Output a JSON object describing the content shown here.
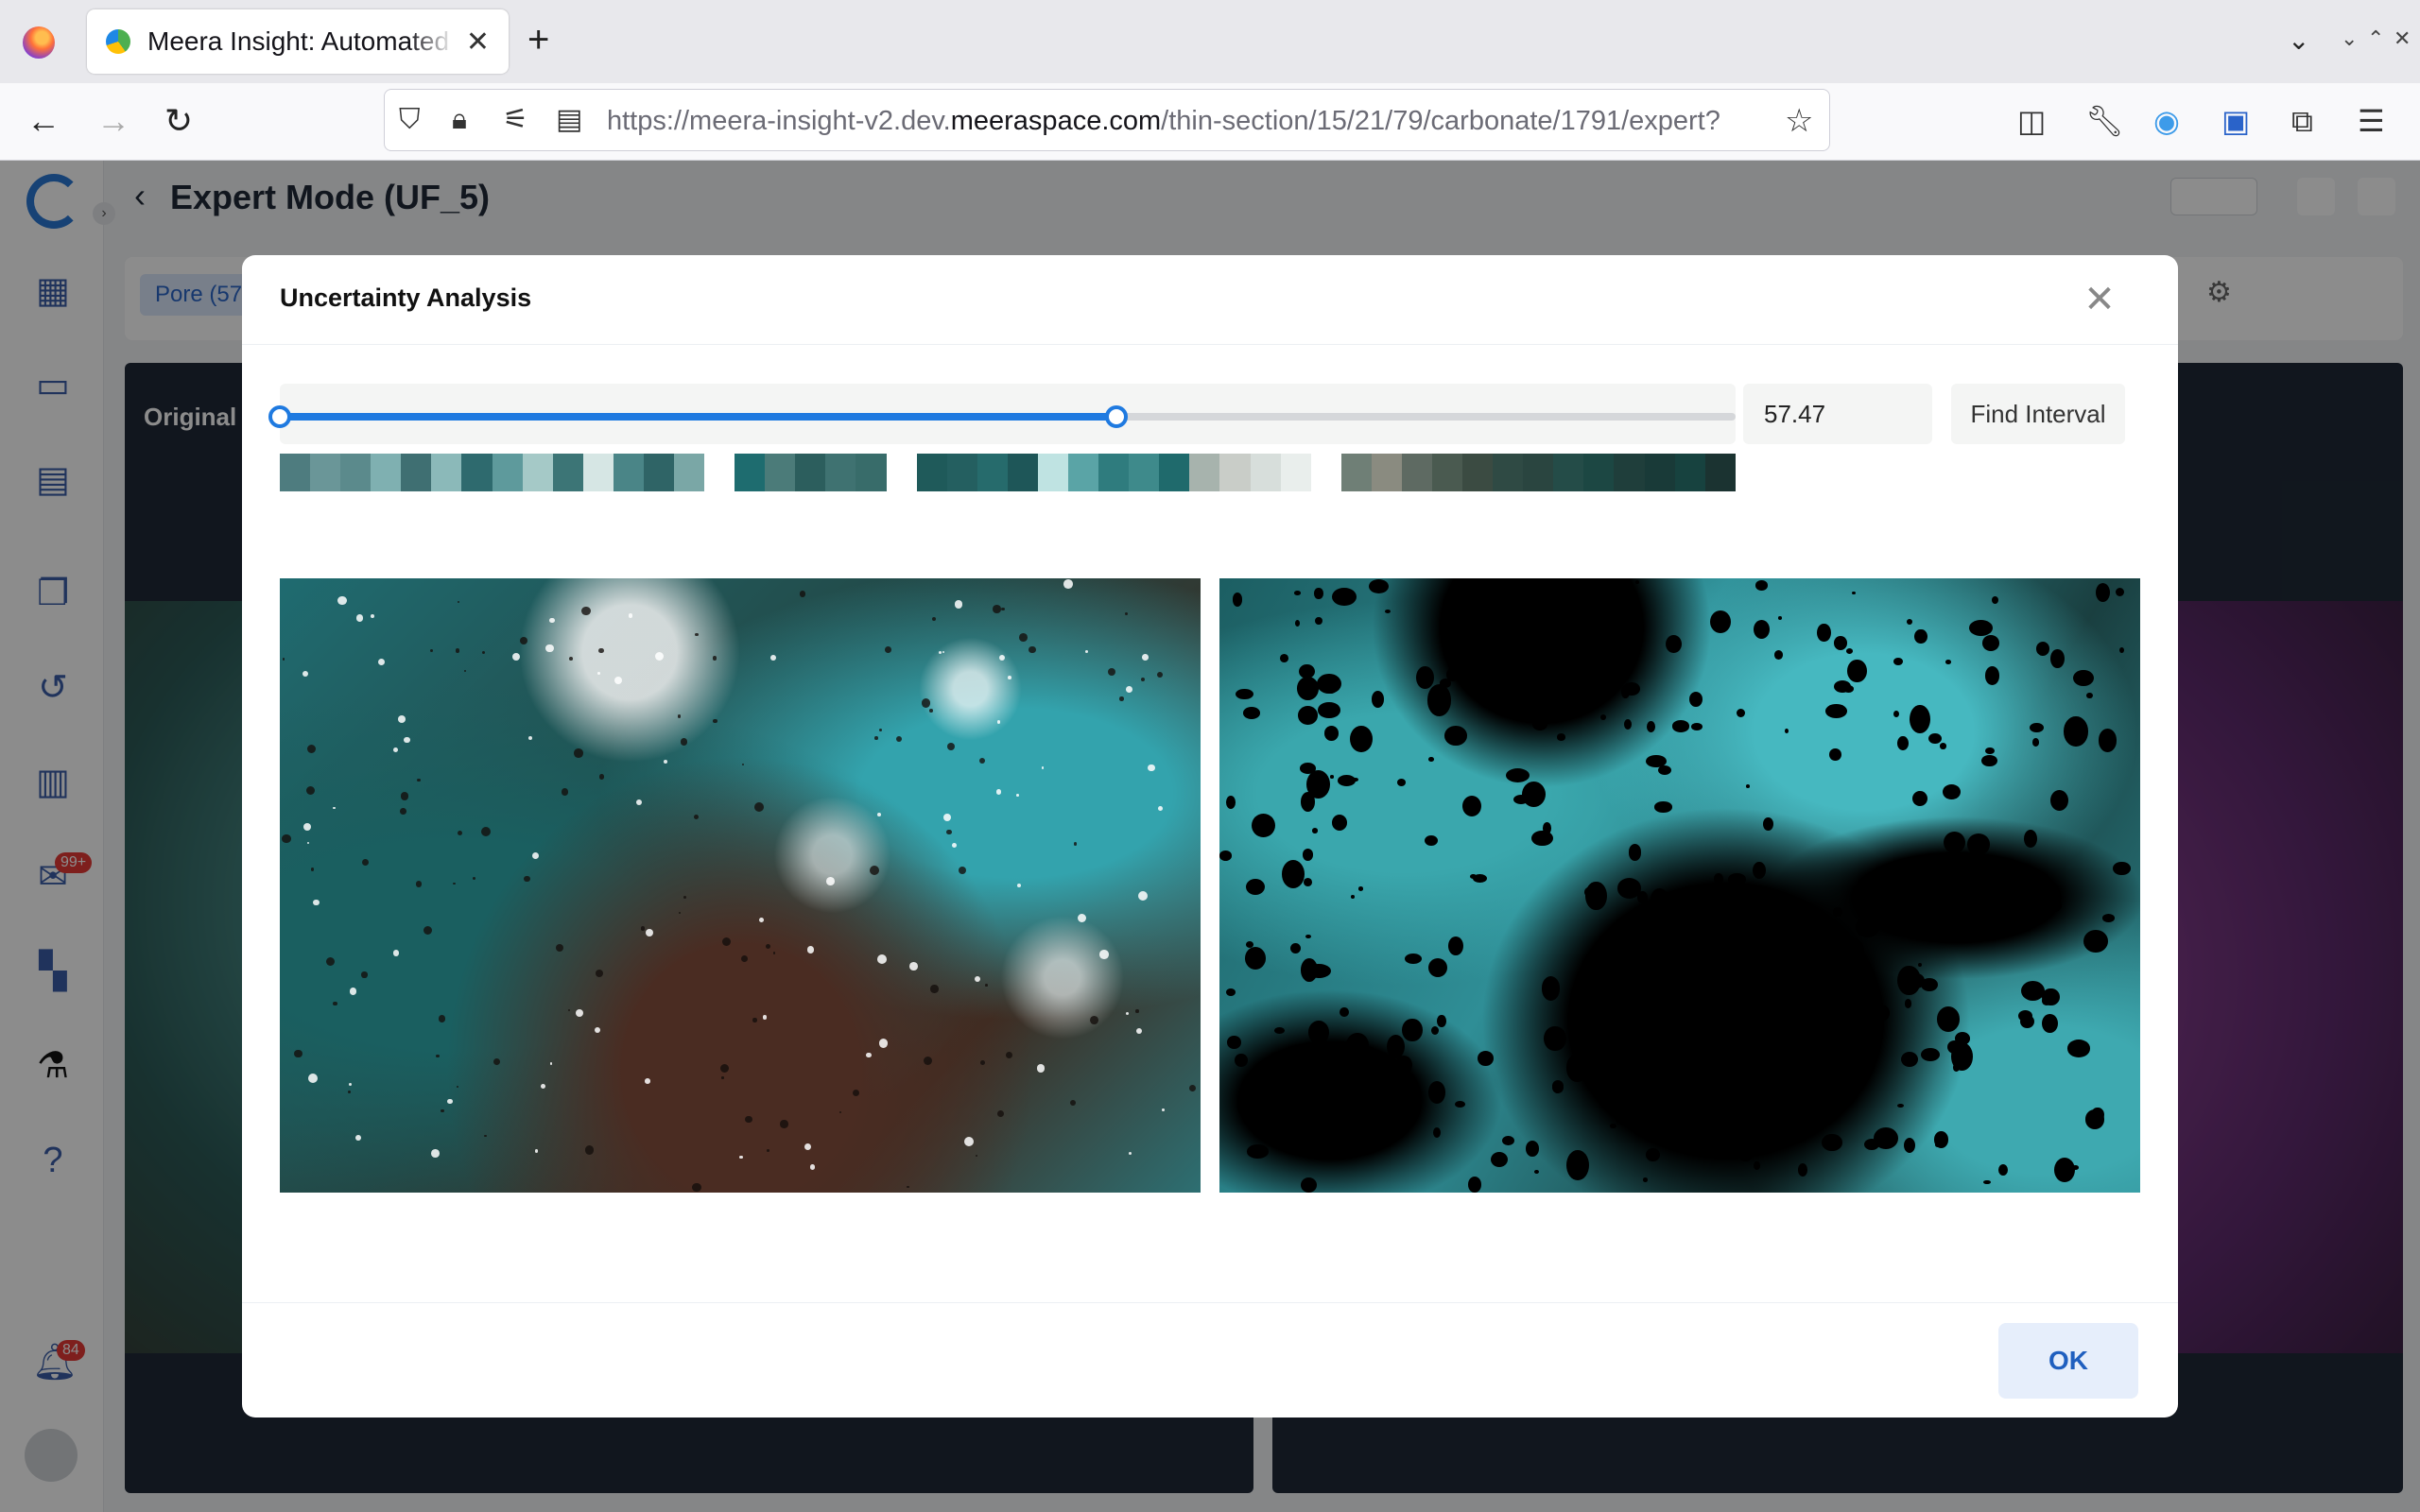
{
  "browser": {
    "tab_title": "Meera Insight: Automated",
    "url_prefix": "https://meera-insight-v2.dev.",
    "url_domain": "meeraspace.com",
    "url_path": "/thin-section/15/21/79/carbonate/1791/expert?"
  },
  "app": {
    "page_title": "Expert Mode (UF_5)",
    "pore_tag": "Pore (57",
    "original_label": "Original",
    "sidebar_badge_messages": "99+",
    "notification_count": "84"
  },
  "modal": {
    "title": "Uncertainty Analysis",
    "slider_value": 57.47,
    "slider_fraction": 0.575,
    "value_text": "57.47",
    "find_interval_label": "Find Interval",
    "ok_label": "OK",
    "swatch_colors": [
      "#4e7c7f",
      "#6a9698",
      "#5b8a8c",
      "#7fb0b1",
      "#3f6f72",
      "#8bb9b9",
      "#2e6a6e",
      "#5e9a9c",
      "#a5c9c7",
      "#3c7576",
      "#d6e6e4",
      "#4a8587",
      "#2f6466",
      "#7aa7a6",
      "#ffffff",
      "#1e6c6f",
      "#4b7b79",
      "#2c5e5d",
      "#3f7271",
      "#386c6a",
      "#ffffff",
      "#1f5a5a",
      "#245f60",
      "#266b6c",
      "#1e5658",
      "#bfe3e2",
      "#5aa4a6",
      "#2f7c7e",
      "#3e8a8b",
      "#1f6a6c",
      "#a7b3ad",
      "#c9cdc8",
      "#d7dedb",
      "#e9eeec",
      "#ffffff",
      "#6f7f76",
      "#8a8b80",
      "#5e6a62",
      "#4a5a50",
      "#3b4b42",
      "#2f4a44",
      "#2a4540",
      "#244c48",
      "#1c4743",
      "#1f3e3b",
      "#193a38",
      "#17423f",
      "#1b3331"
    ]
  }
}
